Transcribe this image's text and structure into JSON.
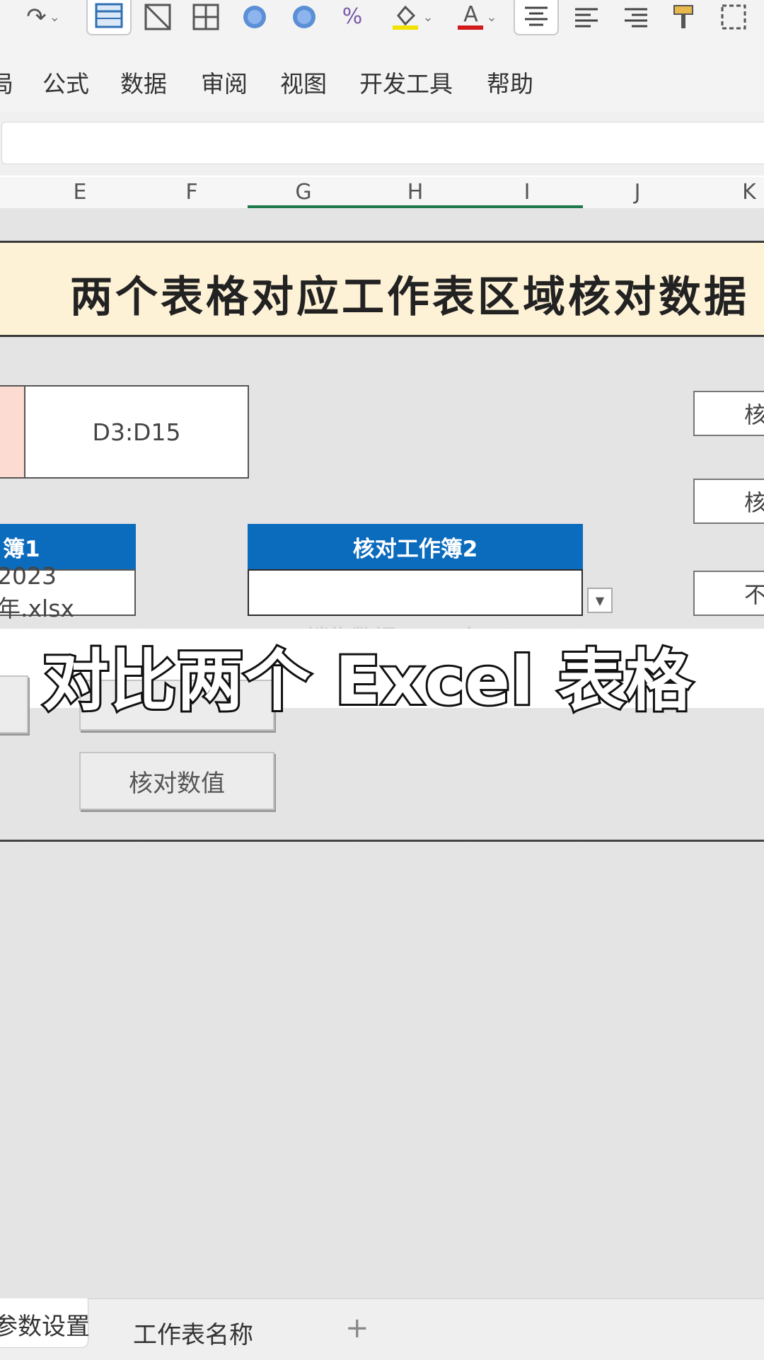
{
  "toolbar": {
    "icons": [
      "redo-icon",
      "insert-table-icon",
      "sheet-icon",
      "border-grid-icon",
      "fill-circle-icon",
      "fill-circle-icon",
      "percent-icon",
      "fill-color-icon",
      "font-color-icon",
      "align-center-icon",
      "align-left-icon",
      "align-right-icon",
      "format-painter-icon",
      "frame-icon"
    ],
    "font_color_letter": "A"
  },
  "menu": {
    "partial_first": "局",
    "items": [
      "公式",
      "数据",
      "审阅",
      "视图",
      "开发工具",
      "帮助"
    ]
  },
  "columns": [
    "E",
    "F",
    "G",
    "H",
    "I",
    "J",
    "K"
  ],
  "banner": {
    "title": "两个表格对应工作表区域核对数据"
  },
  "range_cell": {
    "value": "D3:D15"
  },
  "side_buttons": [
    "核",
    "核",
    "不"
  ],
  "workbook1": {
    "header": "簿1",
    "value": "2023年.xlsx"
  },
  "workbook2": {
    "header": "核对工作簿2",
    "value": ""
  },
  "dropdown_ghost": "276-销售数据-2023年.xlsx",
  "caption": "对比两个 Excel 表格",
  "buttons": {
    "check_values": "核对数值"
  },
  "tabs": {
    "active": "参数设置",
    "second": "工作表名称",
    "add": "+"
  },
  "colors": {
    "header_blue": "#0b6bbd",
    "banner_bg": "#fdf1d6",
    "pink": "#fbdbd2",
    "selection_green": "#1e7a4a"
  }
}
